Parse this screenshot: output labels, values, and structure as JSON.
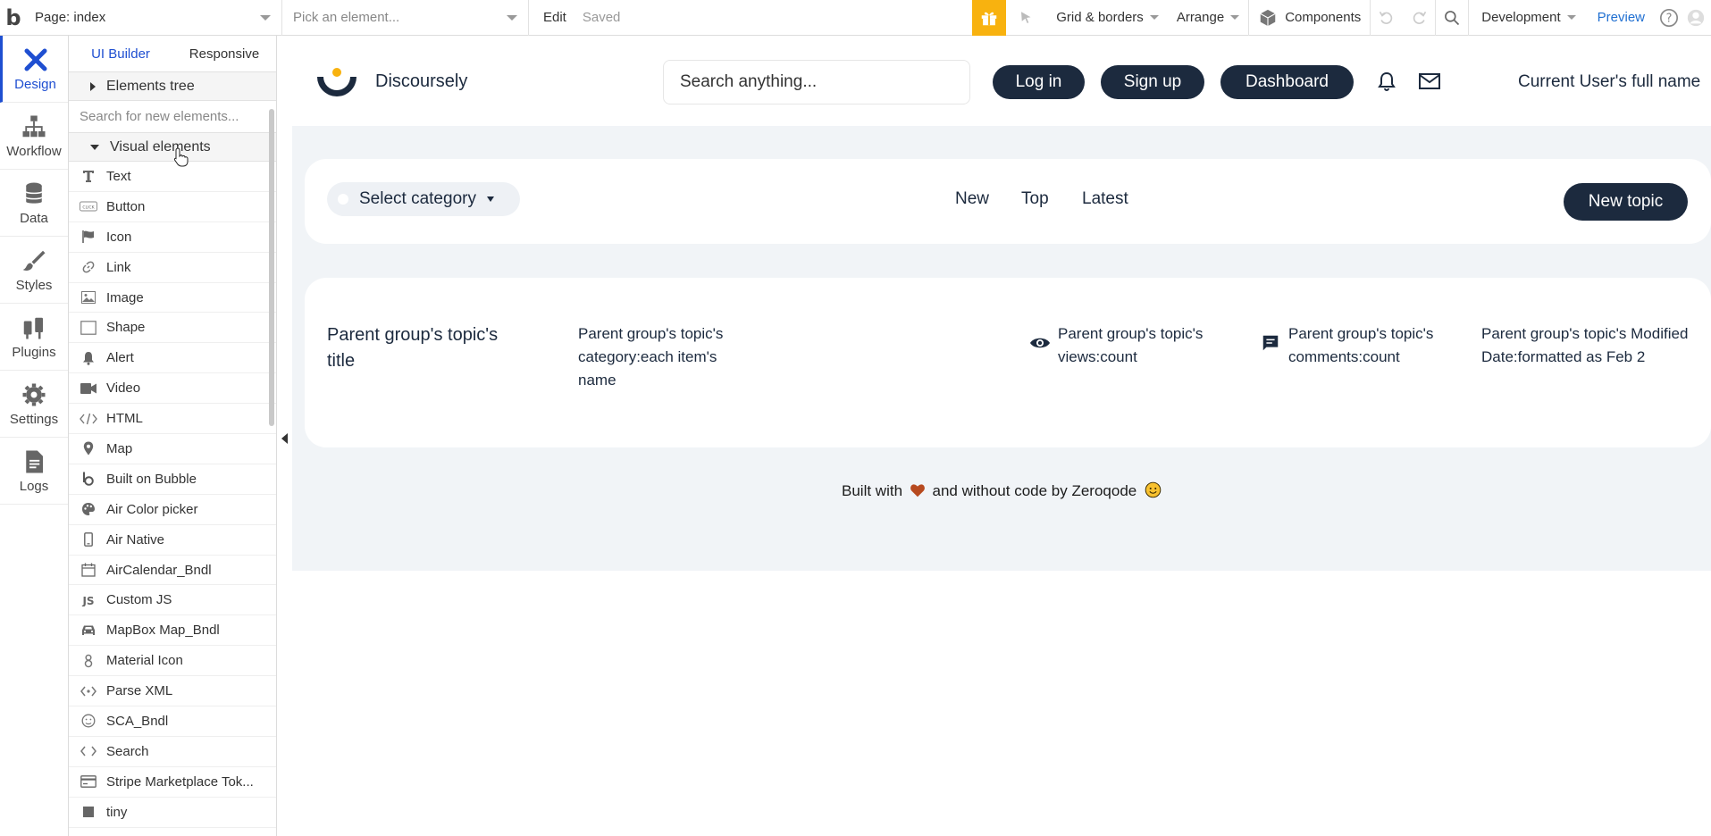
{
  "topbar": {
    "logo": "b",
    "page_label": "Page: index",
    "element_picker": "Pick an element...",
    "edit": "Edit",
    "saved": "Saved",
    "grid": "Grid & borders",
    "arrange": "Arrange",
    "components": "Components",
    "env": "Development",
    "preview": "Preview"
  },
  "leftnav": [
    {
      "label": "Design"
    },
    {
      "label": "Workflow"
    },
    {
      "label": "Data"
    },
    {
      "label": "Styles"
    },
    {
      "label": "Plugins"
    },
    {
      "label": "Settings"
    },
    {
      "label": "Logs"
    }
  ],
  "panel": {
    "tabs": [
      "UI Builder",
      "Responsive"
    ],
    "elements_tree": "Elements tree",
    "search_placeholder": "Search for new elements...",
    "visual_elements": "Visual elements",
    "items": [
      {
        "label": "Text",
        "icon": "text-icon"
      },
      {
        "label": "Button",
        "icon": "button-icon"
      },
      {
        "label": "Icon",
        "icon": "flag-icon"
      },
      {
        "label": "Link",
        "icon": "link-icon"
      },
      {
        "label": "Image",
        "icon": "image-icon"
      },
      {
        "label": "Shape",
        "icon": "shape-icon"
      },
      {
        "label": "Alert",
        "icon": "bell-icon"
      },
      {
        "label": "Video",
        "icon": "video-icon"
      },
      {
        "label": "HTML",
        "icon": "code-icon"
      },
      {
        "label": "Map",
        "icon": "map-pin-icon"
      },
      {
        "label": "Built on Bubble",
        "icon": "bubble-icon"
      },
      {
        "label": "Air Color picker",
        "icon": "palette-icon"
      },
      {
        "label": "Air Native",
        "icon": "phone-icon"
      },
      {
        "label": "AirCalendar_Bndl",
        "icon": "calendar-icon"
      },
      {
        "label": "Custom JS",
        "icon": "js-icon"
      },
      {
        "label": "MapBox Map_Bndl",
        "icon": "car-icon"
      },
      {
        "label": "Material Icon",
        "icon": "material-icon"
      },
      {
        "label": "Parse XML",
        "icon": "xml-icon"
      },
      {
        "label": "SCA_Bndl",
        "icon": "smile-icon"
      },
      {
        "label": "Search",
        "icon": "search-code-icon"
      },
      {
        "label": "Stripe Marketplace Tok...",
        "icon": "card-icon"
      },
      {
        "label": "tiny",
        "icon": "square-icon"
      }
    ]
  },
  "app": {
    "brand": "Discoursely",
    "search_placeholder": "Search anything...",
    "login": "Log in",
    "signup": "Sign up",
    "dashboard": "Dashboard",
    "user_name": "Current User's full name",
    "category_select": "Select category",
    "tabs": [
      "New",
      "Top",
      "Latest"
    ],
    "new_topic": "New topic",
    "topic": {
      "title": "Parent group's topic's title",
      "category": "Parent group's topic's category:each item's name",
      "views": "Parent group's topic's views:count",
      "comments": "Parent group's topic's comments:count",
      "modified": "Parent group's topic's Modified Date:formatted as Feb 2"
    },
    "footer": {
      "pre": "Built with",
      "post": "and without code by Zeroqode"
    }
  },
  "colors": {
    "accent": "#1f4fd1",
    "dark_navy": "#1c2a3e",
    "gift": "#f8b20f",
    "canvas_bg": "#f1f4f7"
  }
}
